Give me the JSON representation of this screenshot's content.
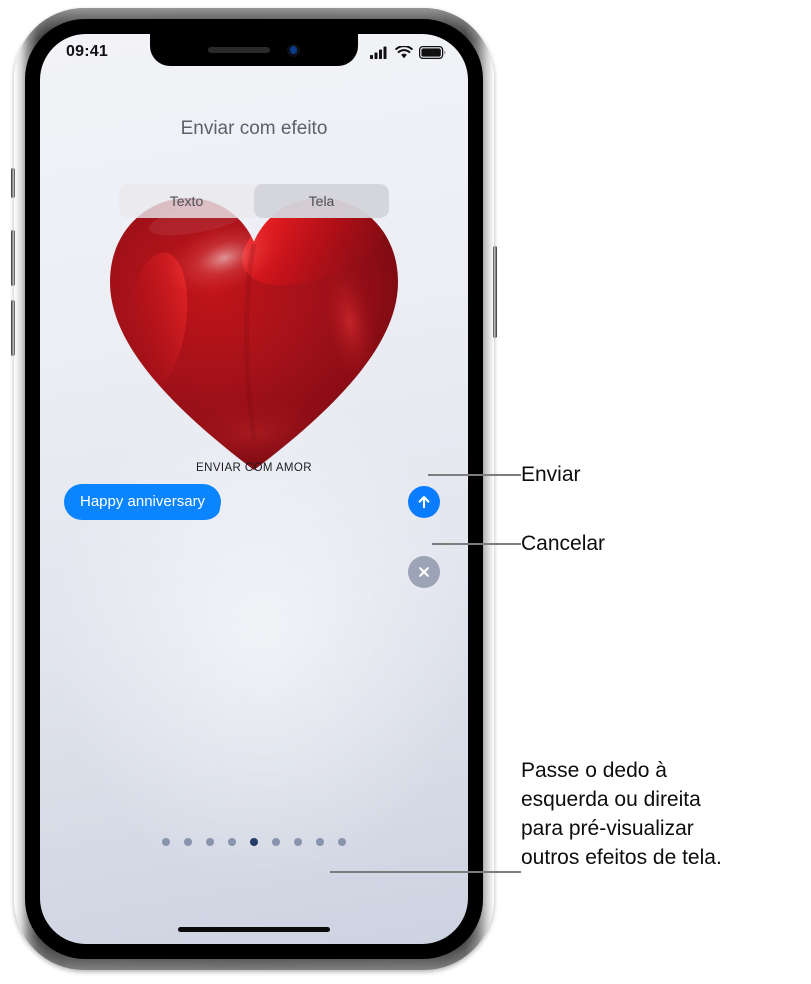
{
  "device": {
    "status_bar": {
      "time": "09:41",
      "cellular_icon": "signal-bars-icon",
      "wifi_icon": "wifi-icon",
      "battery_icon": "battery-full-icon"
    },
    "home_indicator": "home-indicator"
  },
  "sheet": {
    "title": "Enviar com efeito",
    "segmented_control": {
      "options": [
        "Texto",
        "Tela"
      ],
      "selected": "Tela"
    },
    "effect": {
      "name": "ENVIAR COM AMOR",
      "graphic": "red-heart-balloon"
    },
    "message": {
      "bubble_text": "Happy anniversary",
      "bubble_color": "#0A84FF",
      "send_button": {
        "icon": "arrow-up-icon",
        "color": "#0A7CFF"
      },
      "cancel_button": {
        "icon": "close-x-icon",
        "color": "#9BA3B4"
      }
    },
    "page_dots": {
      "count": 9,
      "active_index": 4,
      "dot_color": "#8893AD",
      "active_color": "#273B6B"
    }
  },
  "callouts": [
    {
      "id": "send",
      "label": "Enviar"
    },
    {
      "id": "cancel",
      "label": "Cancelar"
    },
    {
      "id": "swipe",
      "label": "Passe o dedo à\nesquerda ou direita\npara pré-visualizar\noutros efeitos de tela."
    }
  ]
}
